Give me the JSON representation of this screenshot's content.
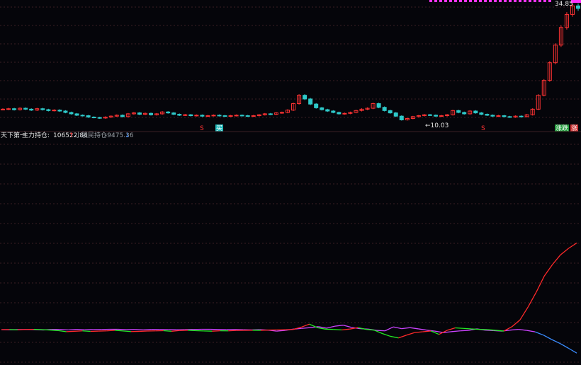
{
  "colors": {
    "background": "#05050a",
    "grid": "#3a1e24",
    "up": "#ff3333",
    "down": "#2ec9c9",
    "white_text": "#e6e6e6",
    "grey_text": "#9aa0a6",
    "mainforce_line_up": "#ff2a2a",
    "mainforce_line_down": "#22ee22",
    "retail_line": "#cc44ff",
    "retail_line_tail": "#3a8cff",
    "top_banner": "#ff33ff"
  },
  "chart_data": [
    {
      "type": "candlestick",
      "panel": "price",
      "annotations": {
        "high_marker": "34.85",
        "low_marker": "←10.03",
        "signals": [
          "S",
          "买",
          "S",
          "涨跌",
          "涨"
        ]
      },
      "series": [
        {
          "values": [
            12.6,
            12.7,
            12.5,
            12.8,
            12.6,
            12.4,
            12.7,
            12.5,
            12.3,
            12.4,
            12.2,
            11.9,
            11.6,
            11.3,
            11.2,
            10.9,
            10.8,
            10.7,
            10.9,
            11.1,
            11.3,
            11.0,
            11.6,
            11.8,
            11.5,
            11.7,
            11.4,
            11.6,
            12.0,
            11.8,
            11.5,
            11.3,
            11.4,
            11.2,
            11.3,
            11.1,
            11.2,
            11.3,
            11.2,
            11.1,
            11.2,
            11.3,
            11.2,
            11.1,
            11.2,
            11.4,
            11.6,
            11.5,
            11.8,
            11.9,
            12.4,
            13.8,
            15.6,
            14.8,
            13.7,
            12.9,
            12.5,
            12.2,
            11.9,
            11.6,
            11.7,
            11.9,
            12.3,
            12.6,
            12.8,
            13.8,
            13.0,
            12.3,
            11.8,
            11.1,
            10.3,
            10.6,
            11.0,
            11.2,
            11.4,
            11.3,
            11.1,
            11.2,
            11.4,
            12.3,
            11.9,
            11.6,
            12.2,
            11.8,
            11.5,
            11.3,
            11.1,
            11.2,
            11.0,
            10.9,
            11.1,
            11.0,
            11.4,
            12.6,
            15.6,
            18.8,
            22.6,
            26.4,
            30.2,
            33.0,
            34.85,
            34.3
          ],
          "note": "approximate closing prices read from the chart"
        }
      ]
    },
    {
      "type": "line",
      "panel": "indicator",
      "legend": {
        "name": "天下第一",
        "series_1_label": "主力持仓:",
        "series_1_value": "106522.84",
        "series_1_arrow": "↑",
        "series_2_label": "小股民持仓:",
        "series_2_value": "-9475.36",
        "series_2_arrow": "↓"
      },
      "series": [
        {
          "name": "主力持仓",
          "values": [
            0,
            100,
            -200,
            200,
            300,
            0,
            -500,
            -1200,
            -2500,
            -2000,
            -1500,
            -2200,
            -1800,
            -1500,
            -900,
            -1600,
            -2400,
            -2100,
            -1700,
            -1500,
            -1300,
            -2000,
            -1100,
            -700,
            -1300,
            -1600,
            -1900,
            -1400,
            -1500,
            -1000,
            -900,
            -700,
            -800,
            -500,
            -300,
            -100,
            200,
            3000,
            6800,
            2400,
            600,
            200,
            -300,
            700,
            2500,
            300,
            -600,
            -4800,
            -8200,
            -10200,
            -6700,
            -3600,
            -2600,
            -1700,
            -5800,
            -900,
            2200,
            1500,
            900,
            300,
            0,
            -800,
            -1800,
            3600,
            12000,
            28000,
            46000,
            66000,
            80000,
            92000,
            100000,
            106522.84
          ]
        },
        {
          "name": "小股民持仓",
          "values": [
            0,
            -50,
            20,
            80,
            0,
            -120,
            50,
            60,
            -100,
            100,
            -30,
            40,
            80,
            150,
            120,
            -20,
            60,
            -80,
            100,
            80,
            40,
            -60,
            0,
            60,
            140,
            120,
            60,
            40,
            20,
            -60,
            -100,
            0,
            -200,
            -600,
            -300,
            200,
            500,
            800,
            1200,
            600,
            1400,
            1800,
            900,
            400,
            200,
            -300,
            -500,
            1100,
            400,
            800,
            300,
            -200,
            -600,
            -1200,
            -800,
            -500,
            -300,
            300,
            -200,
            -400,
            -600,
            -200,
            100,
            -300,
            -900,
            -2200,
            -4000,
            -5600,
            -7500,
            -9475.36
          ]
        }
      ]
    }
  ]
}
